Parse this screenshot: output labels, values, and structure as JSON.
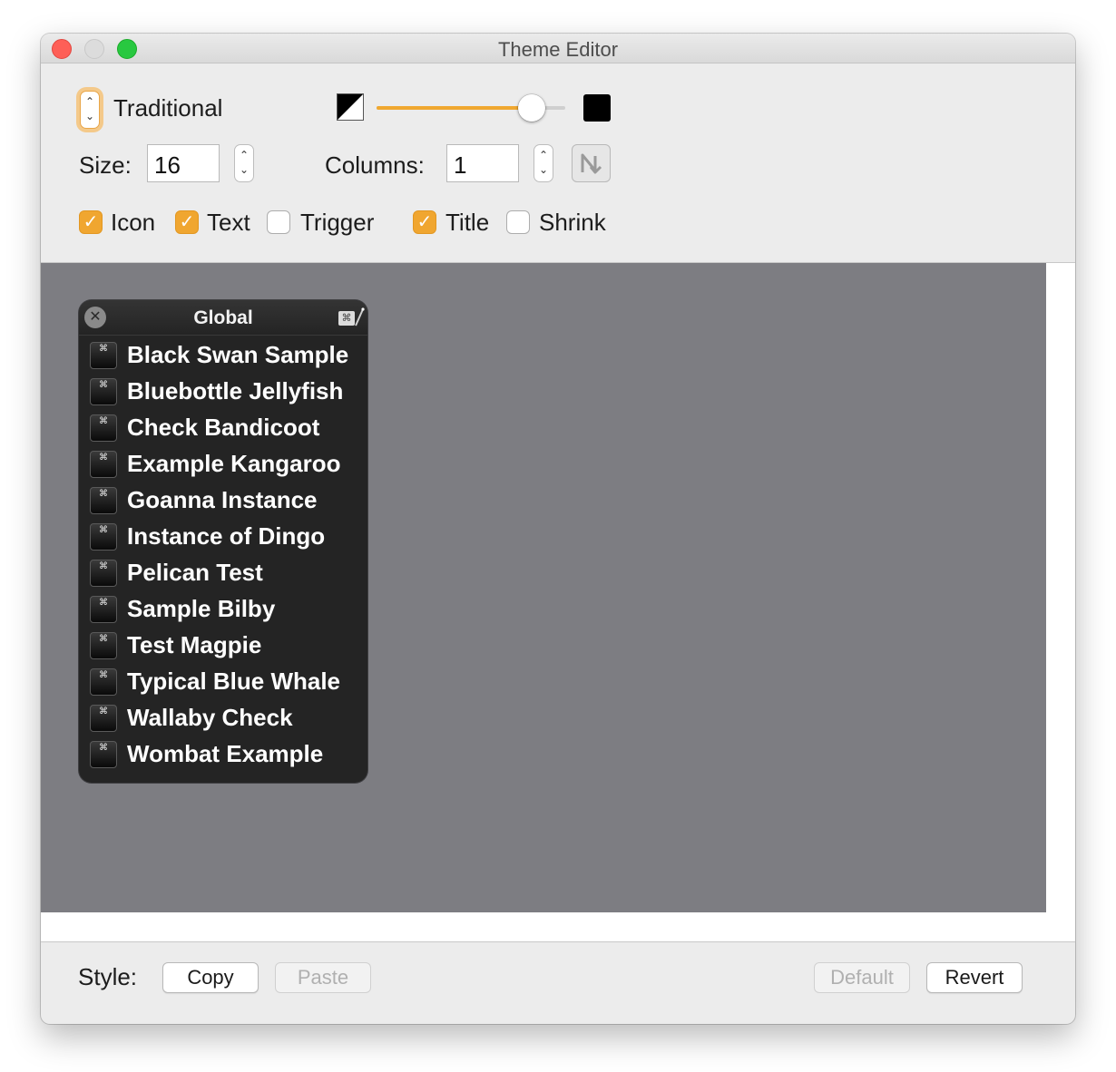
{
  "window": {
    "title": "Theme Editor"
  },
  "theme_selector": {
    "label": "Traditional"
  },
  "opacity_slider": {
    "value_percent": 82
  },
  "size": {
    "label": "Size:",
    "value": "16"
  },
  "columns": {
    "label": "Columns:",
    "value": "1"
  },
  "checkboxes": [
    {
      "label": "Icon",
      "checked": true
    },
    {
      "label": "Text",
      "checked": true
    },
    {
      "label": "Trigger",
      "checked": false
    },
    {
      "label": "Title",
      "checked": true
    },
    {
      "label": "Shrink",
      "checked": false
    }
  ],
  "palette": {
    "title": "Global",
    "items": [
      "Black Swan Sample",
      "Bluebottle Jellyfish",
      "Check Bandicoot",
      "Example Kangaroo",
      "Goanna Instance",
      "Instance of Dingo",
      "Pelican Test",
      "Sample Bilby",
      "Test Magpie",
      "Typical Blue Whale",
      "Wallaby Check",
      "Wombat Example"
    ]
  },
  "footer": {
    "style_label": "Style:",
    "copy": "Copy",
    "paste": "Paste",
    "default": "Default",
    "revert": "Revert"
  },
  "colors": {
    "accent": "#f0a630",
    "preview_background": "#7d7d82",
    "palette_background": "#242424"
  },
  "icons": {
    "theme_stepper": "up-down-chevron-icon",
    "half_swatch": "half-black-white-swatch-icon",
    "black_swatch": "black-swatch-icon",
    "arrange": "zigzag-arrow-icon",
    "palette_close": "close-x-icon",
    "palette_hotkey": "command-key-icon",
    "macro": "command-key-icon"
  }
}
